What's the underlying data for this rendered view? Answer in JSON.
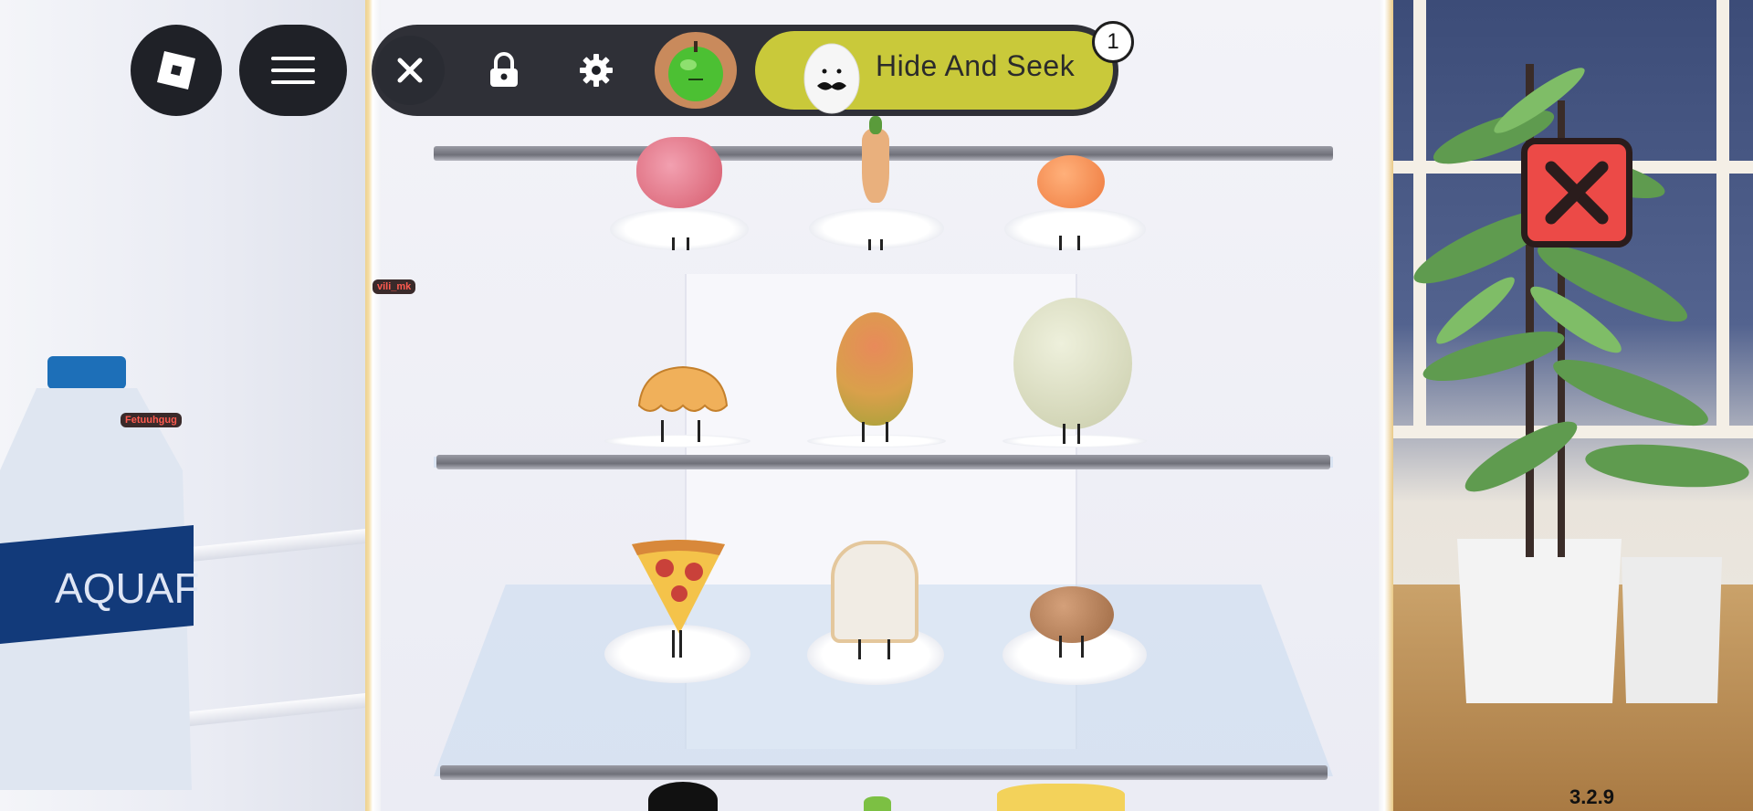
{
  "hud": {
    "game_name": "Hide And Seek",
    "notification_count": "1",
    "version": "3.2.9"
  },
  "players": [
    {
      "name": "Fetuuhgug"
    },
    {
      "name": "vili_mk"
    }
  ],
  "water_bottle": {
    "label": "AQUAFI"
  },
  "colors": {
    "game_pill": "#c9c93a",
    "close_button": "#ec4a47",
    "hud_dark": "#1f2127",
    "nametag_text": "#ff5a4f"
  },
  "icons": {
    "roblox_menu": "roblox-logo-icon",
    "main_menu": "hamburger-icon",
    "close": "close-icon",
    "lock": "lock-icon",
    "settings": "gear-icon",
    "avatar": "green-apple-avatar-icon",
    "game_character": "egg-mustache-icon",
    "big_close": "close-x-icon"
  }
}
